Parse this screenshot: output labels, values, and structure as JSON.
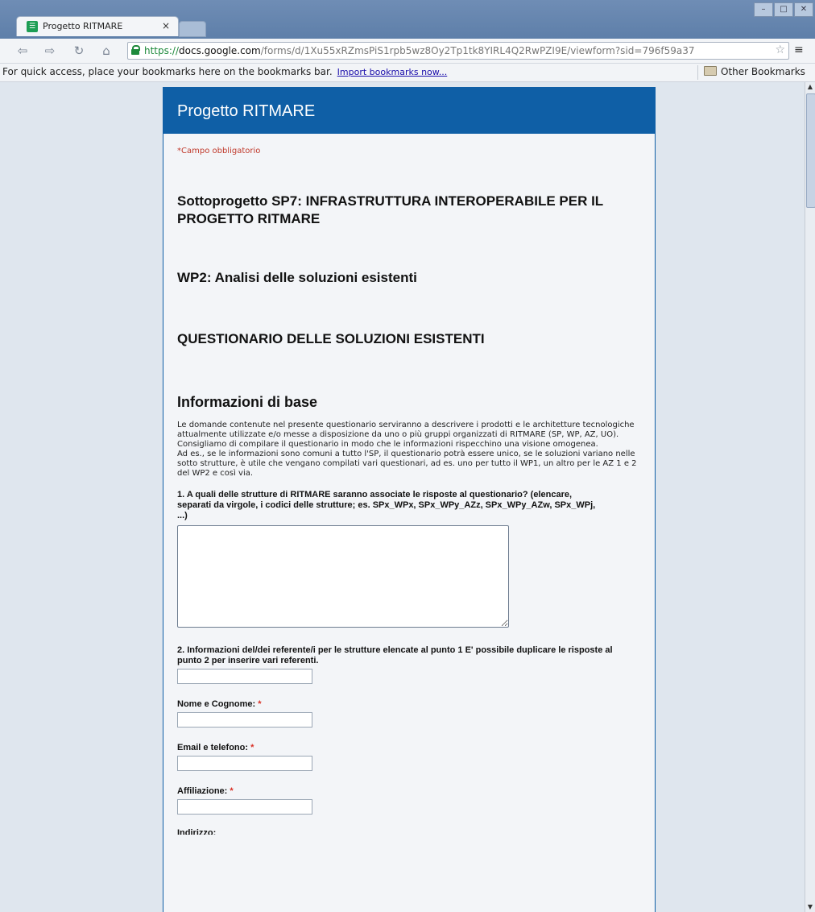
{
  "browser": {
    "tab_title": "Progetto RITMARE",
    "tab_close": "×",
    "url_scheme": "https://",
    "url_host": "docs.google.com",
    "url_path": "/forms/d/1Xu55xRZmsPiS1rpb5wz8Oy2Tp1tk8YIRL4Q2RwPZI9E/viewform?sid=796f59a37",
    "bookmarks_text": "For quick access, place your bookmarks here on the bookmarks bar.",
    "import_link": "Import bookmarks now...",
    "other_bookmarks": "Other Bookmarks",
    "icons": [
      "back-icon",
      "forward-icon",
      "reload-icon",
      "home-icon",
      "lock-icon",
      "star-icon",
      "menu-icon",
      "folder-icon"
    ]
  },
  "form": {
    "title": "Progetto RITMARE",
    "required_note": "*Campo obbligatorio",
    "heading_1": "Sottoprogetto SP7: INFRASTRUTTURA INTEROPERABILE PER IL PROGETTO RITMARE",
    "heading_2": "WP2: Analisi delle soluzioni esistenti",
    "heading_3": "QUESTIONARIO DELLE SOLUZIONI ESISTENTI",
    "heading_4": "Informazioni di base",
    "description": [
      "Le domande contenute nel presente questionario serviranno a descrivere i prodotti e le architetture tecnologiche attualmente utilizzate e/o messe a disposizione da uno o più gruppi organizzati di RITMARE (SP, WP, AZ, UO).",
      "Consigliamo di compilare il questionario in modo che le informazioni rispecchino una visione omogenea.",
      "Ad es., se le informazioni sono comuni a tutto l'SP, il questionario potrà essere unico, se le soluzioni variano nelle sotto strutture, è utile che vengano compilati vari questionari, ad es. uno per tutto il WP1, un altro per le AZ 1 e 2 del WP2 e così via."
    ],
    "q1_label": "1. A quali delle strutture di RITMARE saranno associate le risposte al questionario? (elencare, separati da virgole, i codici delle strutture; es. SPx_WPx, SPx_WPy_AZz, SPx_WPy_AZw, SPx_WPj, ...)",
    "q1_value": "",
    "q2_label": "2. Informazioni del/dei referente/i per le strutture elencate al punto 1 E' possibile duplicare le risposte al punto 2 per inserire vari referenti.",
    "q2_value": "",
    "required_mark": "*",
    "fields": [
      {
        "label": "Nome e Cognome:",
        "required": true,
        "value": ""
      },
      {
        "label": "Email e telefono:",
        "required": true,
        "value": ""
      },
      {
        "label": "Affiliazione:",
        "required": true,
        "value": ""
      }
    ],
    "next_label_partial": "Indirizzo:"
  }
}
